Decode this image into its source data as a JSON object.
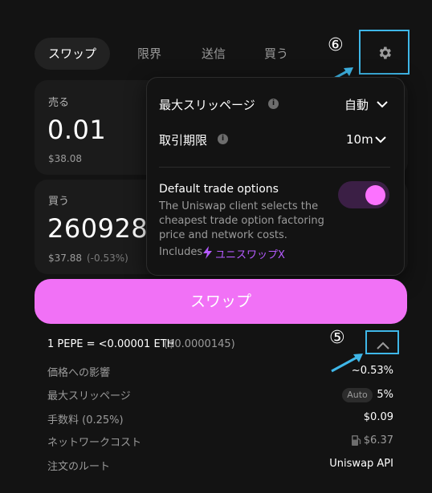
{
  "tabs": [
    {
      "label": "スワップ",
      "active": true
    },
    {
      "label": "限界",
      "active": false
    },
    {
      "label": "送信",
      "active": false
    },
    {
      "label": "買う",
      "active": false
    }
  ],
  "sell": {
    "label": "売る",
    "amount": "0.01",
    "usd": "$38.08"
  },
  "buy": {
    "label": "買う",
    "amount": "260928",
    "usd": "$37.88",
    "change": "(-0.53%)"
  },
  "settings": {
    "max_slippage_label": "最大スリッページ",
    "max_slippage_value": "自動",
    "deadline_label": "取引期限",
    "deadline_value": "10m",
    "default_trade_title": "Default trade options",
    "default_trade_desc": "The Uniswap client selects the cheapest trade option factoring price and network costs.",
    "includes_label": "Includes",
    "includes_link": "ユニスワップX",
    "toggle_on": true
  },
  "swap_button": "スワップ",
  "rate": {
    "text": "1 PEPE = <0.00001 ETH",
    "usd": "($0.0000145)"
  },
  "details": [
    {
      "label": "価格への影響",
      "value": "~0.53%"
    },
    {
      "label": "最大スリッページ",
      "badge": "Auto",
      "value": "5%"
    },
    {
      "label": "手数料 (0.25%)",
      "value": "$0.09"
    },
    {
      "label": "ネットワークコスト",
      "value": "$6.37"
    },
    {
      "label": "注文のルート",
      "value": "Uniswap API"
    }
  ],
  "callouts": {
    "settings": "⑥",
    "details": "⑤"
  },
  "colors": {
    "accent": "#fc72ff",
    "callout": "#3fb7e8",
    "background": "#131313"
  }
}
